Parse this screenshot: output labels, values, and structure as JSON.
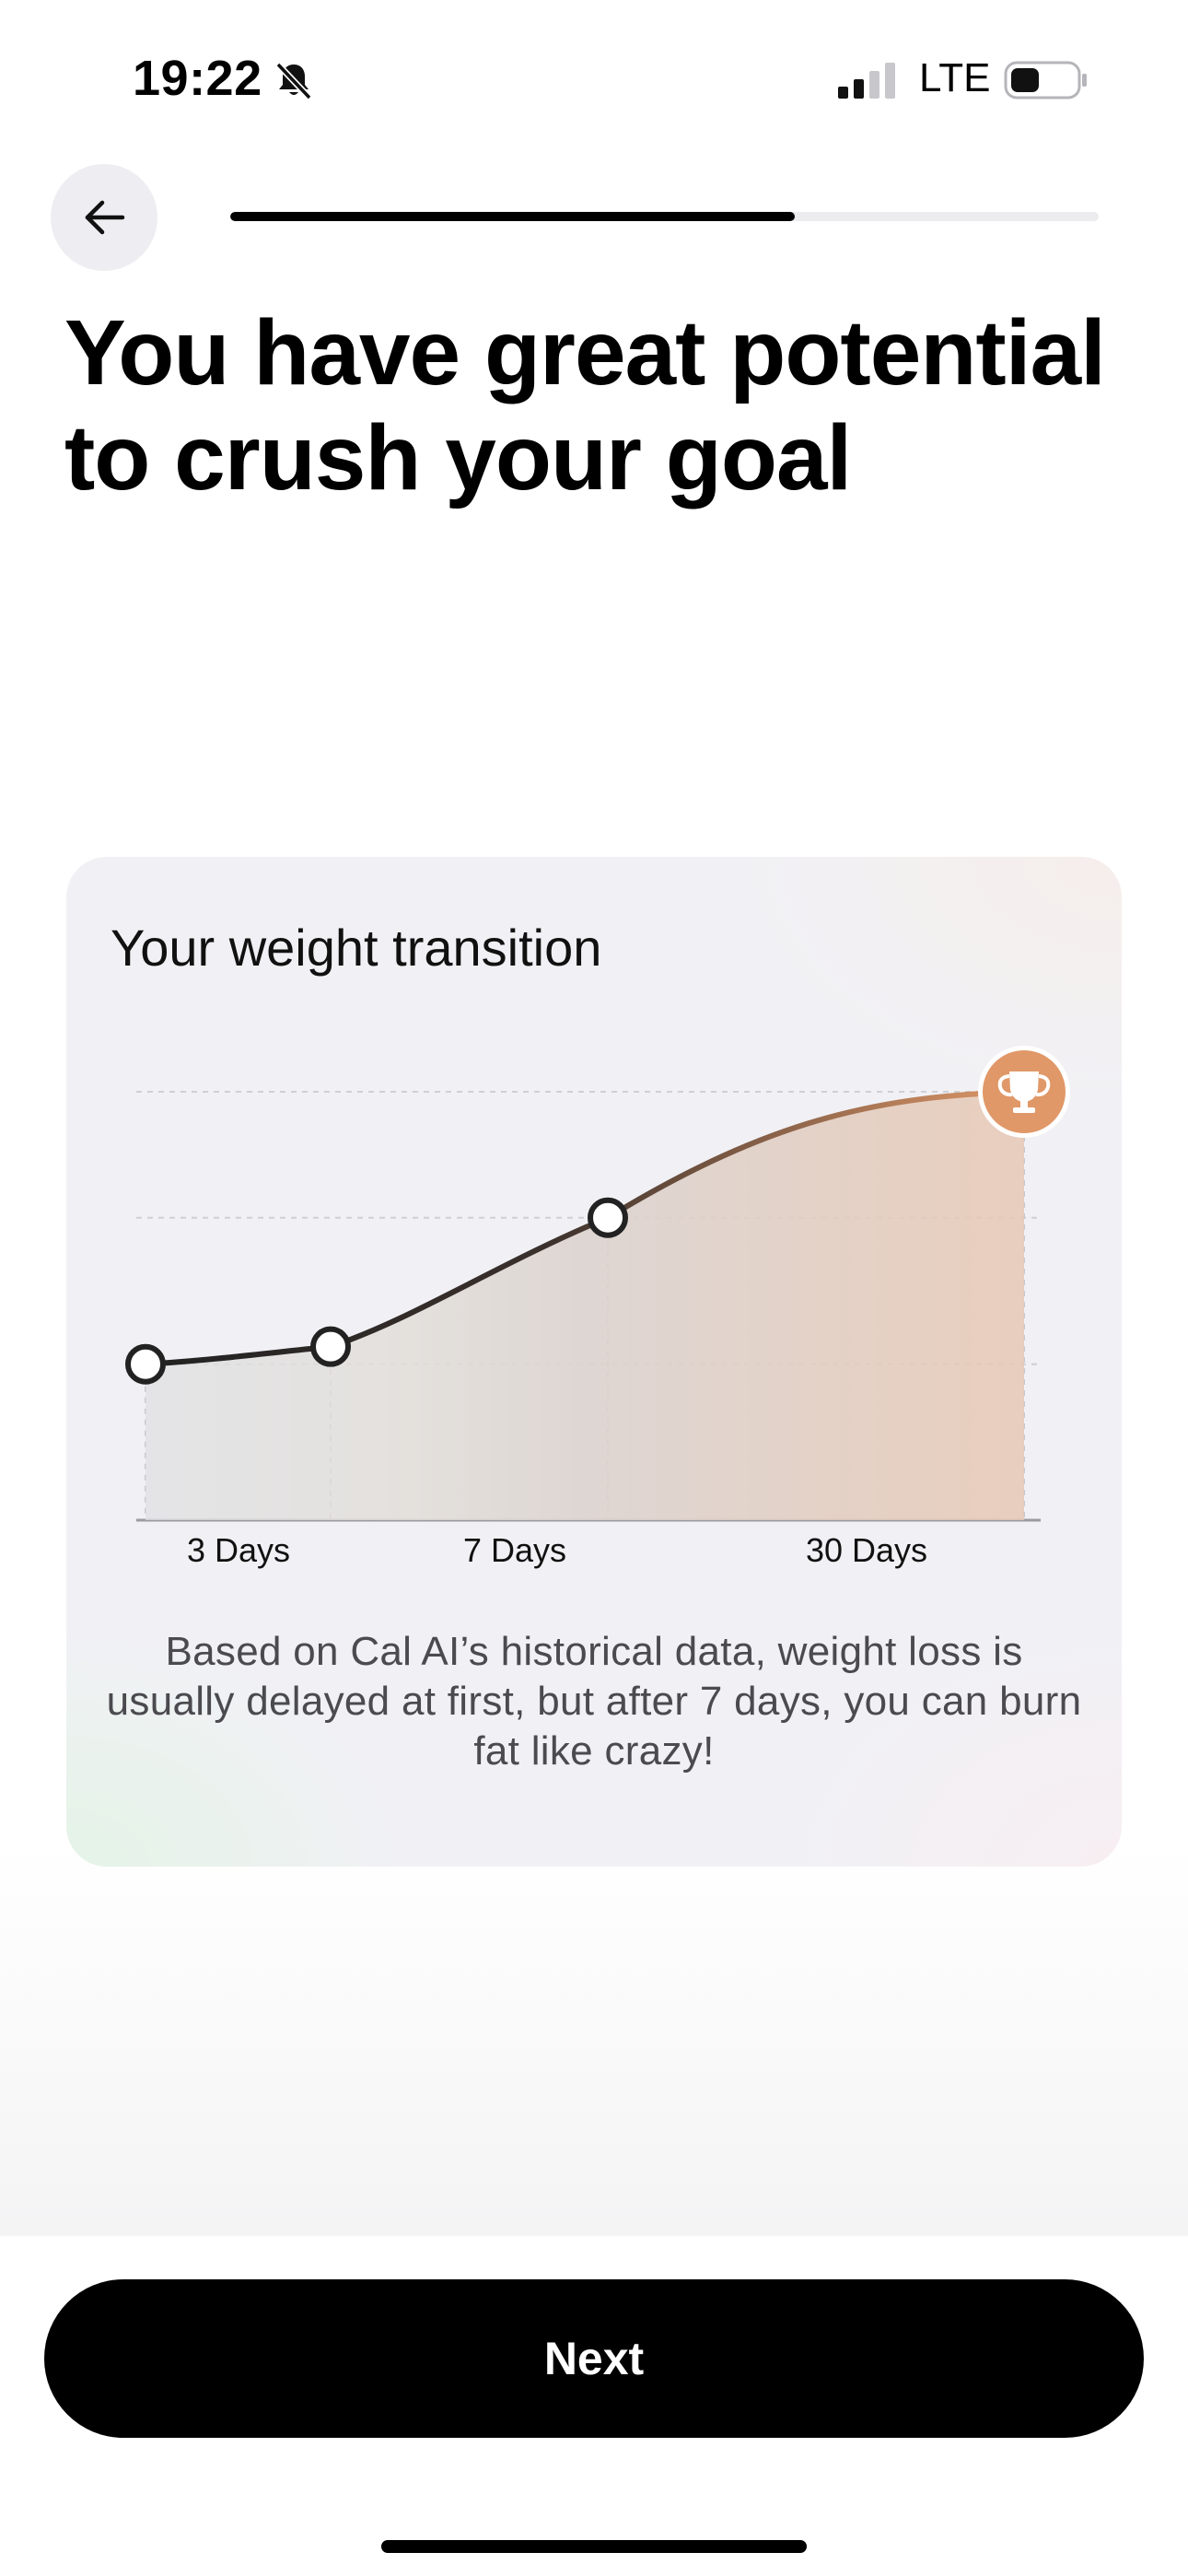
{
  "status_bar": {
    "time": "19:22",
    "network": "LTE",
    "silent_icon": "bell-slash-icon",
    "signal_icon": "cellular-signal-icon",
    "battery_icon": "battery-low-icon"
  },
  "header": {
    "back_icon": "arrow-left-icon",
    "progress": 0.65
  },
  "title": "You have great potential to crush your goal",
  "card": {
    "title": "Your weight transition",
    "caption": "Based on Cal AI’s historical data, weight loss is usually delayed at first, but after 7 days, you can burn fat like crazy!",
    "goal_icon": "trophy-icon",
    "accent_color": "#e09868"
  },
  "chart_data": {
    "type": "area",
    "title": "Your weight transition",
    "tick_labels": [
      "3 Days",
      "7 Days",
      "30 Days"
    ],
    "points": [
      {
        "label": "",
        "x": 0,
        "y": 0.07
      },
      {
        "label": "3 Days",
        "x": 1,
        "y": 0.13
      },
      {
        "label": "7 Days",
        "x": 2,
        "y": 0.57
      },
      {
        "label": "30 Days",
        "x": 3,
        "y": 1.0
      }
    ],
    "grid": true,
    "legend": "none",
    "goal_marker": "trophy-icon"
  },
  "footer": {
    "next_label": "Next"
  }
}
